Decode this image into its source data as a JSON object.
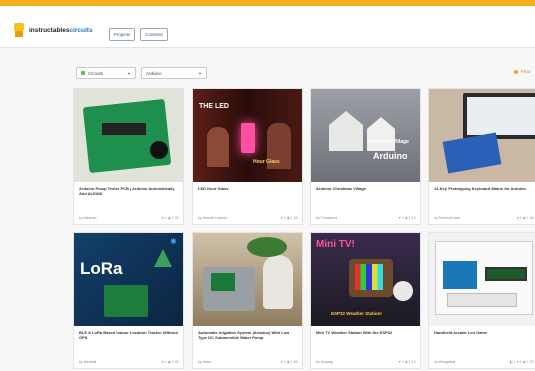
{
  "header": {
    "brand_part1": "instructables",
    "brand_part2": "circuits",
    "projects_label": "Projects",
    "contests_label": "Contests"
  },
  "filters": {
    "category": "Circuits",
    "channel": "Arduino",
    "featured_label": "Feat"
  },
  "cards": [
    {
      "title": "Arduino Pump Tester PCB | Arduino Automatically Add ALEXID",
      "author": "by Akbarrin",
      "channel": "in Arduino",
      "stats": "♥ 1  ◉ 1.3K",
      "thumb_label": ""
    },
    {
      "title": "LED Hour Glass",
      "author": "by Hernati Ladoriu",
      "channel": "in Arduino",
      "stats": "♥ 1  ◉ 1.3K",
      "thumb_label": "THE LED",
      "thumb_sub": "Hour Glass"
    },
    {
      "title": "Arduino Christmas Village",
      "author": "by Transcend",
      "channel": "in Arduino",
      "stats": "♥ 1  ◉ 1.1K",
      "thumb_label": "Christmas Village",
      "thumb_sub": "Arduino"
    },
    {
      "title": "14-Key Prototyping Keyboard Matrix for Arduino",
      "author": "by TechnoCrowd",
      "channel": "in Arduino",
      "stats": "♥ 1  ◉ 1.5K",
      "thumb_label": ""
    },
    {
      "title": "BLE & LoRa Based Indoor Location Tracker Without GPS",
      "author": "by Wendall",
      "channel": "in Arduino",
      "stats": "♥ 1  ◉ 1.4K",
      "thumb_label": "LoRa"
    },
    {
      "title": "Automatic Irrigation System (Arduino) With Low Type DC Submersible Water Pump",
      "author": "by Hann",
      "channel": "in Arduino",
      "stats": "♥ 1  ◉ 1.5K",
      "thumb_label": ""
    },
    {
      "title": "Mini TV Weather Station With the ESP32",
      "author": "by Jhosaig",
      "channel": "in Arduino",
      "stats": "♥ 1  ◉ 1.1K",
      "thumb_label": "Mini TV!",
      "thumb_sub": "ESP32 Weather Station!"
    },
    {
      "title": "Handheld Arcade Led Game",
      "author": "by Wedgeleaf",
      "channel": "in Arduino",
      "stats": "◧ 1  ♥ 1  ◉ 1.2K",
      "thumb_label": ""
    }
  ],
  "colors": {
    "accent": "#f2ae1c",
    "brand_blue": "#2a72b5"
  }
}
